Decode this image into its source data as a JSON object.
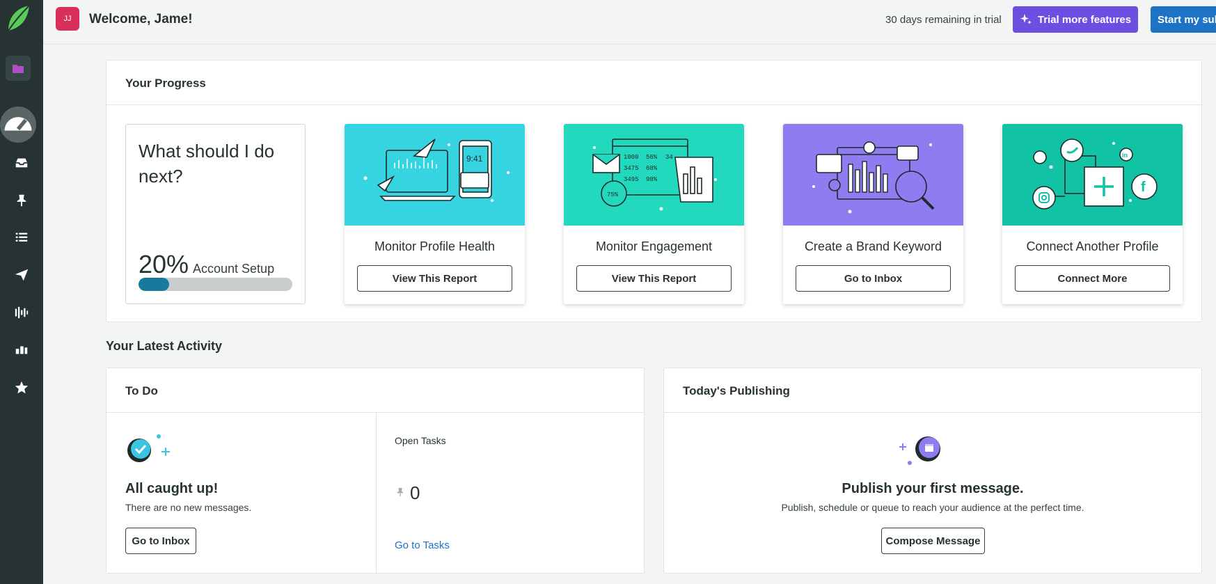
{
  "header": {
    "avatar_initials": "JJ",
    "welcome": "Welcome, Jame!",
    "trial_remaining": "30 days remaining in trial",
    "trial_button": "Trial more features",
    "start_button": "Start my subscription"
  },
  "sidebar": {
    "items": [
      {
        "icon": "folder-icon"
      },
      {
        "icon": "dashboard-icon"
      },
      {
        "icon": "inbox-icon"
      },
      {
        "icon": "pin-icon"
      },
      {
        "icon": "list-icon"
      },
      {
        "icon": "send-icon"
      },
      {
        "icon": "listening-icon"
      },
      {
        "icon": "reports-icon"
      },
      {
        "icon": "star-icon"
      }
    ]
  },
  "progress": {
    "title": "Your Progress",
    "next_title": "What should I do next?",
    "percent": "20%",
    "percent_label": "Account Setup",
    "percent_value": 0.2,
    "cards": [
      {
        "title": "Monitor Profile Health",
        "button": "View This Report",
        "color": "#36d3e0"
      },
      {
        "title": "Monitor Engagement",
        "button": "View This Report",
        "color": "#22d8bd"
      },
      {
        "title": "Create a Brand Keyword",
        "button": "Go to Inbox",
        "color": "#8e7cf0"
      },
      {
        "title": "Connect Another Profile",
        "button": "Connect More",
        "color": "#11c2a5"
      }
    ]
  },
  "activity": {
    "title": "Your Latest Activity",
    "todo": {
      "title": "To Do",
      "caught_up": "All caught up!",
      "no_messages": "There are no new messages.",
      "inbox_button": "Go to Inbox",
      "open_tasks_label": "Open Tasks",
      "open_tasks_count": "0",
      "tasks_link": "Go to Tasks"
    },
    "publishing": {
      "title": "Today's Publishing",
      "heading": "Publish your first message.",
      "subtext": "Publish, schedule or queue to reach your audience at the perfect time.",
      "button": "Compose Message"
    }
  },
  "colors": {
    "sidebar": "#273333",
    "trial_button": "#6c4fe0",
    "start_button": "#1e73c4",
    "link": "#1e73c4",
    "progress_fill": "#177a9c"
  }
}
